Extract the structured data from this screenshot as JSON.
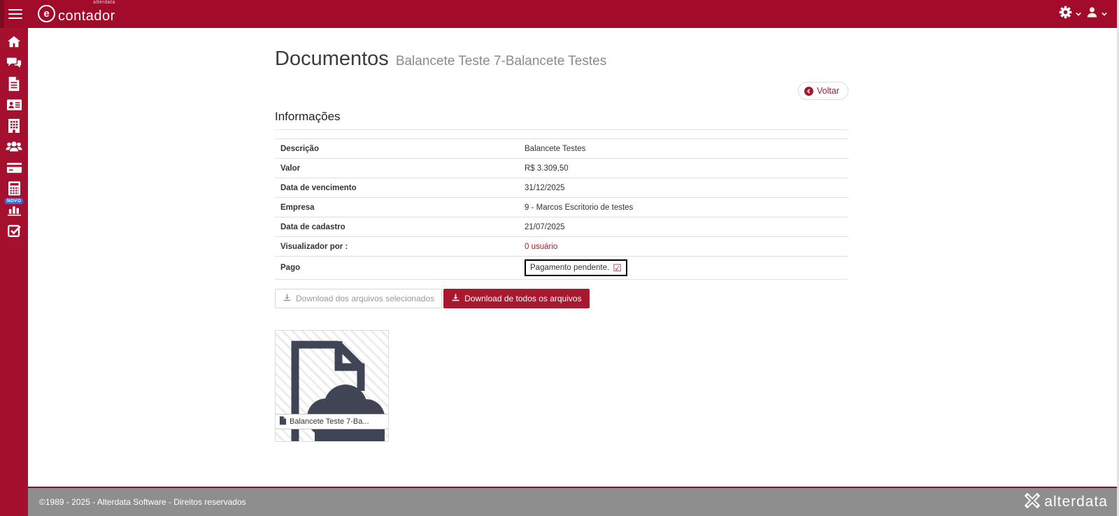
{
  "topbar": {
    "brand": "contador",
    "brand_super": "alterdata"
  },
  "sidebar": {
    "items": [
      {
        "icon": "home-icon"
      },
      {
        "icon": "comments-icon"
      },
      {
        "icon": "document-icon"
      },
      {
        "icon": "id-card-icon"
      },
      {
        "icon": "building-icon"
      },
      {
        "icon": "users-icon"
      },
      {
        "icon": "credit-card-icon"
      },
      {
        "icon": "calculator-icon",
        "badge": "NOVO"
      },
      {
        "icon": "bar-chart-icon"
      },
      {
        "icon": "check-square-icon"
      }
    ]
  },
  "header": {
    "title": "Documentos",
    "subtitle": "Balancete Teste 7-Balancete Testes"
  },
  "actions": {
    "back_label": "Voltar"
  },
  "info": {
    "section_title": "Informações",
    "rows": [
      {
        "label": "Descrição",
        "value": "Balancete Testes"
      },
      {
        "label": "Valor",
        "value": "R$ 3.309,50"
      },
      {
        "label": "Data de vencimento",
        "value": "31/12/2025"
      },
      {
        "label": "Empresa",
        "value": "9 - Marcos Escritorio de testes"
      },
      {
        "label": "Data de cadastro",
        "value": "21/07/2025"
      },
      {
        "label": "Visualizador por :",
        "value": "0 usuário"
      },
      {
        "label": "Pago",
        "value": "Pagamento pendente."
      }
    ]
  },
  "downloads": {
    "selected_label": "Download dos arquivos selecionados",
    "all_label": "Download de todos os arquivos"
  },
  "file_card": {
    "label": "Balancete Teste 7-Ba..."
  },
  "footer": {
    "copyright": "©1989 - 2025 - Alterdata Software - Direitos reservados",
    "logo_text": "alterdata"
  },
  "colors": {
    "topbar": "#a30b2b",
    "sidebar": "#a5102f",
    "accent": "#a6192e",
    "footer": "#8e8e8e",
    "novo_badge": "#2f6fe4",
    "link": "#a6192e"
  }
}
